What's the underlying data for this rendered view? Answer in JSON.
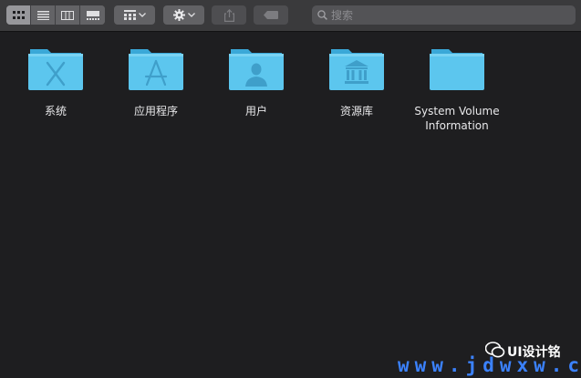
{
  "toolbar": {
    "view_modes": [
      "icon-view",
      "list-view",
      "column-view",
      "gallery-view"
    ],
    "active_view": "icon-view",
    "group_button": "grid-group-icon",
    "action_button": "gear-icon",
    "share_button": "share-icon",
    "tag_button": "tag-icon",
    "search": {
      "placeholder": "搜索",
      "value": ""
    }
  },
  "items": [
    {
      "label": "系统",
      "icon": "system-x-glyph"
    },
    {
      "label": "应用程序",
      "icon": "app-store-glyph"
    },
    {
      "label": "用户",
      "icon": "user-glyph"
    },
    {
      "label": "资源库",
      "icon": "library-columns-glyph"
    },
    {
      "label": "System Volume\nInformation",
      "icon": "plain-folder"
    }
  ],
  "colors": {
    "background": "#1e1e20",
    "toolbar": "#3a3a3c",
    "folder_light": "#5cc6ee",
    "folder_dark": "#3aa8d8",
    "label_text": "#e8e8ea"
  },
  "watermark": {
    "brand": "UI设计铭",
    "url": "www.jdwxw.cn"
  }
}
